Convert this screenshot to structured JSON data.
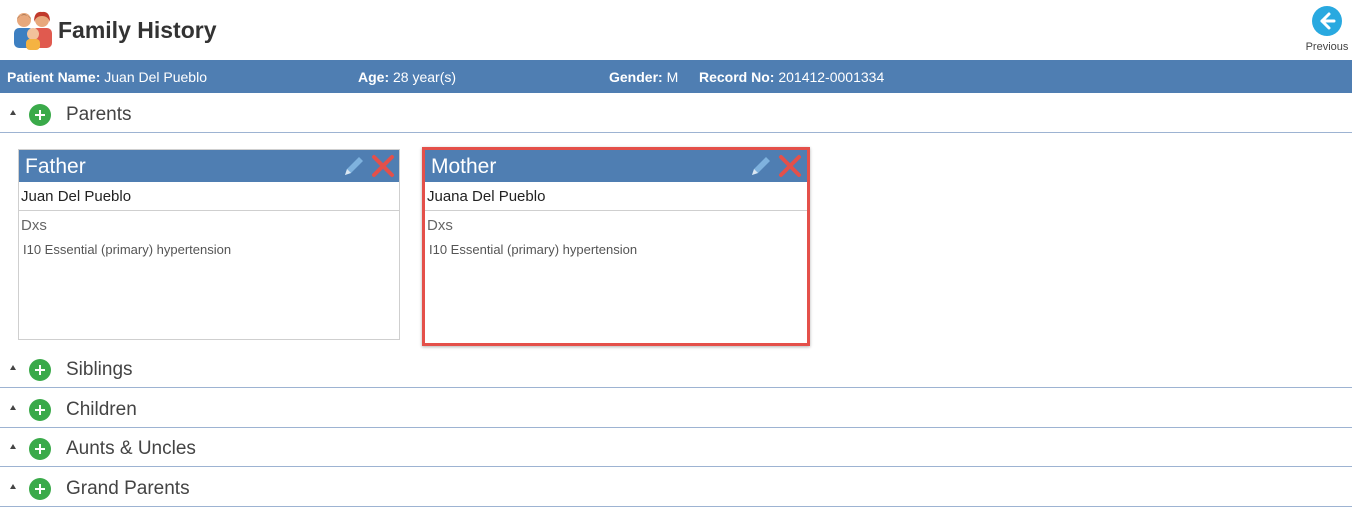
{
  "header": {
    "title": "Family History",
    "previous_label": "Previous"
  },
  "patient": {
    "name_label": "Patient Name:",
    "name": "Juan Del Pueblo",
    "age_label": "Age:",
    "age": "28 year(s)",
    "gender_label": "Gender:",
    "gender": "M",
    "record_label": "Record No:",
    "record": "201412-0001334"
  },
  "sections": [
    {
      "label": "Parents"
    },
    {
      "label": "Siblings"
    },
    {
      "label": "Children"
    },
    {
      "label": "Aunts & Uncles"
    },
    {
      "label": "Grand Parents"
    }
  ],
  "parents": [
    {
      "relation": "Father",
      "name": "Juan  Del Pueblo",
      "dxs_label": "Dxs",
      "dxs": [
        "I10 Essential (primary) hypertension"
      ],
      "selected": false
    },
    {
      "relation": "Mother",
      "name": "Juana  Del Pueblo",
      "dxs_label": "Dxs",
      "dxs": [
        "I10 Essential (primary) hypertension"
      ],
      "selected": true
    }
  ],
  "colors": {
    "accent": "#4f7eb2",
    "add_green": "#3aaa4a",
    "delete_red": "#e4504a",
    "back_blue": "#29a9e0"
  },
  "icons": {
    "header": "family-icon",
    "back": "arrow-left-icon",
    "add": "plus-circle-icon",
    "edit": "pencil-icon",
    "delete": "close-icon",
    "expand": "caret-up-icon"
  }
}
